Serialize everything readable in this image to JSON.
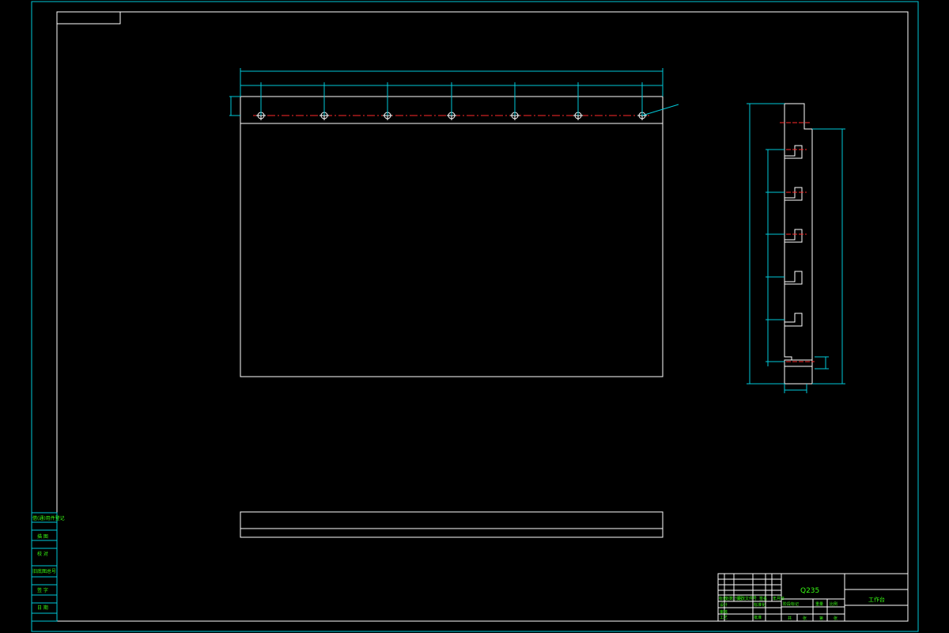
{
  "drawing": {
    "material": "Q235",
    "part_name": "工作台",
    "colors": {
      "background": "#000000",
      "frame": "#00c8d8",
      "geometry": "#ffffff",
      "centerline": "#ff2a2a",
      "title_text": "#39ff14"
    }
  },
  "left_strip": {
    "labels": [
      "借(通)用件登记",
      "描 图",
      "校 对",
      "旧底图总号",
      "签 字",
      "日 期"
    ]
  },
  "title_block": {
    "row_labels_left": [
      "标记",
      "处数",
      "分区",
      "更改文件号",
      "签名",
      "年月日"
    ],
    "design_labels": [
      "设计",
      "标准化"
    ],
    "stage_labels": [
      "阶段标记",
      "重量",
      "比例"
    ],
    "review_labels": [
      "审核",
      "工艺"
    ],
    "approve_labels": [
      "批准"
    ],
    "sheet_labels": [
      "共",
      "张",
      "第",
      "张"
    ]
  }
}
